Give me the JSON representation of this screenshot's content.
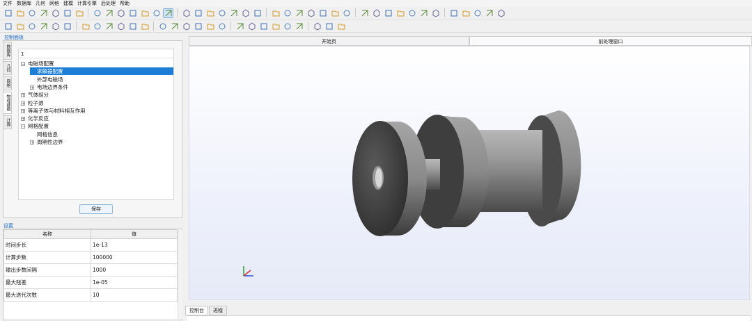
{
  "menu": [
    "文件",
    "数据库",
    "几何",
    "网格",
    "建模",
    "计算引擎",
    "后处理",
    "帮助"
  ],
  "toolbar1_icons": [
    "new-file-icon",
    "open-file-icon",
    "save-icon",
    "save-as-icon",
    "import-icon",
    "list-icon",
    "grid-icon",
    "axis-icon",
    "axis-icon",
    "axis-icon",
    "axis-icon",
    "axis-icon",
    "axis-icon",
    "filter-icon",
    "select-icon",
    "select-icon",
    "select-icon",
    "select-icon",
    "pick-icon",
    "pick-icon",
    "pick-icon",
    "pick-icon",
    "cube-icon",
    "cube-icon",
    "cube-icon",
    "cube-icon",
    "box-icon",
    "box-icon",
    "box-icon",
    "box-icon",
    "view-front-icon",
    "view-side-icon",
    "view-top-icon",
    "view-iso-icon",
    "view-iso-icon",
    "view-iso-icon",
    "view-iso-icon",
    "view-iso-icon",
    "undo-icon",
    "redo-icon"
  ],
  "toolbar2_icons": [
    "sketch-icon",
    "rectangle-icon",
    "shape-icon",
    "shape-icon",
    "sphere-icon",
    "rect-icon",
    "line-icon",
    "polyline-icon",
    "polygon-icon",
    "extrude-icon",
    "extrude-icon",
    "extrude-icon",
    "face-icon",
    "face-icon",
    "mirror-icon",
    "move-icon",
    "rotate-icon",
    "align-icon",
    "plane-icon",
    "transform-icon",
    "section-icon",
    "section-icon",
    "boolean-icon",
    "boolean-icon",
    "boolean-icon",
    "boolean-icon",
    "measure-icon"
  ],
  "control_panel": {
    "title": "控制面板",
    "vertical_tabs": [
      "数据库",
      "几何",
      "网格",
      "物理建模",
      "计算"
    ],
    "search_value": "1",
    "tree": [
      {
        "label": "电磁场配置",
        "level": 0,
        "toggle": "⊟"
      },
      {
        "label": "求解器配置",
        "level": 1,
        "toggle": "",
        "selected": true
      },
      {
        "label": "外部电磁场",
        "level": 1,
        "toggle": ""
      },
      {
        "label": "电场边界条件",
        "level": 1,
        "toggle": "⊞"
      },
      {
        "label": "气体组分",
        "level": 0,
        "toggle": "⊞"
      },
      {
        "label": "粒子源",
        "level": 0,
        "toggle": "⊞"
      },
      {
        "label": "等离子体与材料相互作用",
        "level": 0,
        "toggle": "⊞"
      },
      {
        "label": "化学反应",
        "level": 0,
        "toggle": "⊞"
      },
      {
        "label": "网格配置",
        "level": 0,
        "toggle": "⊟"
      },
      {
        "label": "网格信息",
        "level": 1,
        "toggle": ""
      },
      {
        "label": "周期性边界",
        "level": 1,
        "toggle": "⊞"
      }
    ],
    "save_label": "保存"
  },
  "settings": {
    "title": "设置",
    "col_name": "名称",
    "col_value": "值",
    "rows": [
      {
        "name": "时间步长",
        "value": "1e-13"
      },
      {
        "name": "计算步数",
        "value": "100000"
      },
      {
        "name": "输出步数间隔",
        "value": "1000"
      },
      {
        "name": "最大残差",
        "value": "1e-05"
      },
      {
        "name": "最大迭代次数",
        "value": "10"
      }
    ]
  },
  "tabs": {
    "start": "开始页",
    "post": "前处理窗口"
  },
  "bottom_tabs": {
    "console": "控制台",
    "progress": "进程"
  },
  "colors": {
    "accent": "#1c7ed6",
    "title": "#1f6fc6"
  }
}
